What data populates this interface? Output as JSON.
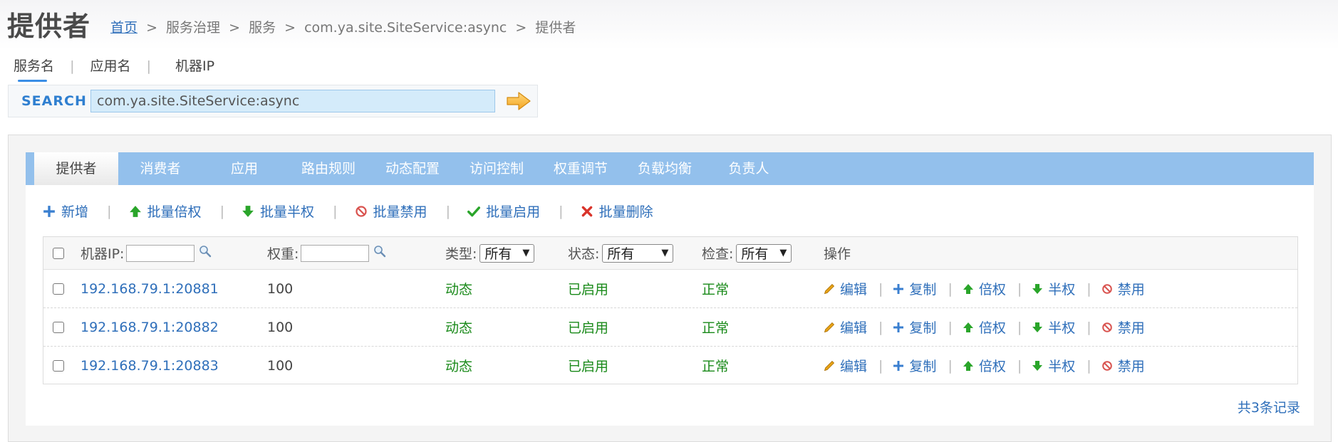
{
  "page": {
    "title": "提供者",
    "breadcrumb": {
      "home": "首页",
      "separator": ">",
      "items": [
        "服务治理",
        "服务",
        "com.ya.site.SiteService:async",
        "提供者"
      ]
    }
  },
  "search_tabs": [
    "服务名",
    "应用名",
    "机器IP"
  ],
  "search_tabs_active": 0,
  "search": {
    "label": "SEARCH",
    "value": "com.ya.site.SiteService:async",
    "go_icon": "arrow-right-icon"
  },
  "tabs": [
    "提供者",
    "消费者",
    "应用",
    "路由规则",
    "动态配置",
    "访问控制",
    "权重调节",
    "负载均衡",
    "负责人"
  ],
  "tabs_active": 0,
  "toolbar": {
    "add": "新增",
    "batch_double": "批量倍权",
    "batch_half": "批量半权",
    "batch_disable": "批量禁用",
    "batch_enable": "批量启用",
    "batch_delete": "批量删除"
  },
  "table": {
    "headers": {
      "ip": "机器IP:",
      "weight": "权重:",
      "type": "类型:",
      "status": "状态:",
      "check": "检查:",
      "ops": "操作"
    },
    "filters": {
      "type": "所有",
      "status": "所有",
      "check": "所有"
    },
    "rows": [
      {
        "ip": "192.168.79.1:20881",
        "weight": "100",
        "type": "动态",
        "status": "已启用",
        "check": "正常"
      },
      {
        "ip": "192.168.79.1:20882",
        "weight": "100",
        "type": "动态",
        "status": "已启用",
        "check": "正常"
      },
      {
        "ip": "192.168.79.1:20883",
        "weight": "100",
        "type": "动态",
        "status": "已启用",
        "check": "正常"
      }
    ],
    "actions": {
      "edit": "编辑",
      "copy": "复制",
      "double": "倍权",
      "half": "半权",
      "disable": "禁用"
    }
  },
  "footer": {
    "count_text": "共3条记录"
  },
  "colors": {
    "link": "#2f6fba",
    "tabbar": "#93c0ec",
    "green": "#1a8a1a",
    "up_arrow": "#2aa52a",
    "delete": "#d9342b",
    "disable": "#d9534f",
    "edit": "#e8a317"
  }
}
